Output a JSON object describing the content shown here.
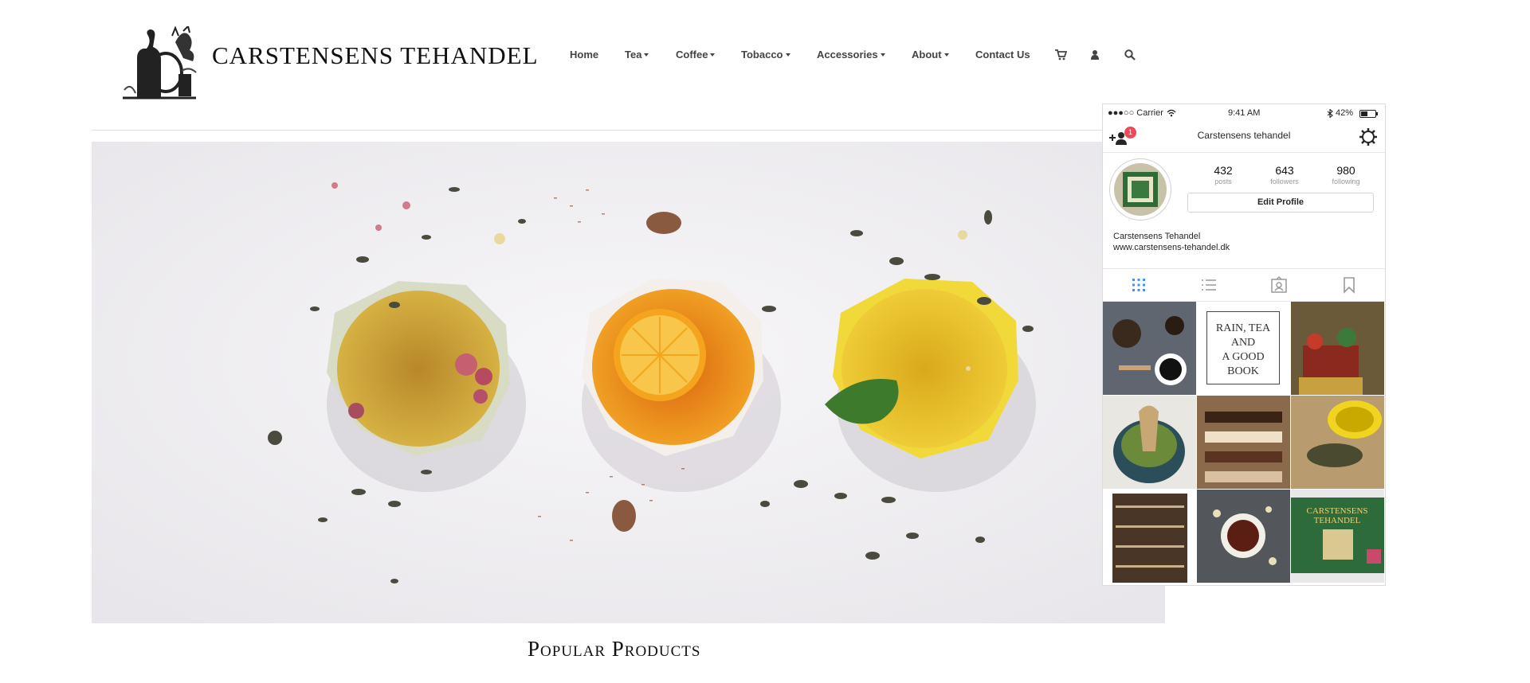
{
  "header": {
    "brand": "CARSTENSENS TEHANDEL",
    "nav": [
      {
        "label": "Home",
        "dropdown": false
      },
      {
        "label": "Tea",
        "dropdown": true
      },
      {
        "label": "Coffee",
        "dropdown": true
      },
      {
        "label": "Tobacco",
        "dropdown": true
      },
      {
        "label": "Accessories",
        "dropdown": true
      },
      {
        "label": "About",
        "dropdown": true
      },
      {
        "label": "Contact Us",
        "dropdown": false
      }
    ],
    "icons": [
      "cart-icon",
      "user-icon",
      "search-icon"
    ]
  },
  "hero": {
    "image": "three bowls of tea with rose buds, lemon slice and mint leaf on white background",
    "colors": {
      "bg": "#f1f0f3",
      "cup1": "#c9a23a",
      "cup2": "#e98a1c",
      "cup3": "#e8c020"
    }
  },
  "section": {
    "title": "Popular Products"
  },
  "phone": {
    "status": {
      "carrier": "●●●○○ Carrier",
      "time": "9:41 AM",
      "battery": "42%"
    },
    "title": "Carstensens tehandel",
    "notification_count": "1",
    "stats": [
      {
        "num": "432",
        "label": "posts"
      },
      {
        "num": "643",
        "label": "followers"
      },
      {
        "num": "980",
        "label": "following"
      }
    ],
    "edit_profile": "Edit Profile",
    "bio_name": "Carstensens Tehandel",
    "bio_url": "www.carstensens-tehandel.dk",
    "tabs": [
      "grid-icon",
      "list-icon",
      "tagged-icon",
      "bookmark-icon"
    ],
    "posts": [
      {
        "name": "coffee-tools-post",
        "bg": "#5f6670"
      },
      {
        "name": "quote-post",
        "bg": "#ffffff",
        "lines": [
          "RAIN, TEA",
          "AND",
          "A GOOD",
          "BOOK"
        ]
      },
      {
        "name": "shop-display-post",
        "bg": "#6b5a3a"
      },
      {
        "name": "matcha-whisk-post",
        "bg": "#e9e7e2"
      },
      {
        "name": "chocolates-post",
        "bg": "#8a6a4a"
      },
      {
        "name": "yellow-cup-post",
        "bg": "#b89b6e"
      },
      {
        "name": "shop-shelves-post",
        "bg": "#4a3626"
      },
      {
        "name": "tea-cup-post",
        "bg": "#53575c"
      },
      {
        "name": "shop-sign-post",
        "bg": "#2e6b3a",
        "sign": [
          "CARSTENSENS",
          "TEHANDEL"
        ]
      }
    ]
  }
}
